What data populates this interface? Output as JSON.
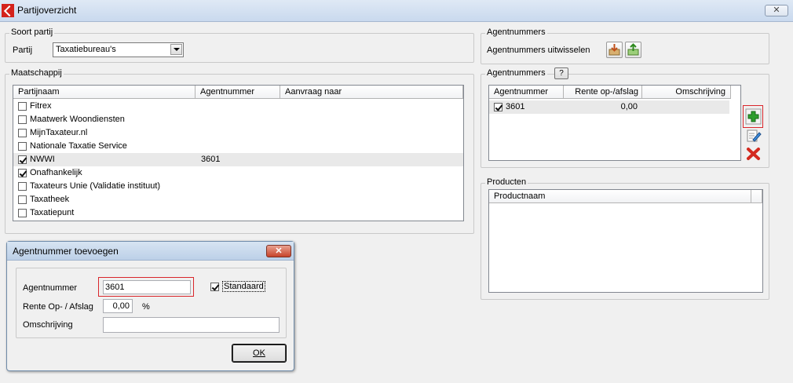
{
  "window": {
    "title": "Partijoverzicht",
    "close_glyph": "✕",
    "icon": "app-logo-icon"
  },
  "soort_partij": {
    "legend": "Soort partij",
    "partij_label": "Partij",
    "partij_value": "Taxatiebureau's"
  },
  "maatschappij": {
    "legend": "Maatschappij",
    "columns": [
      "Partijnaam",
      "Agentnummer",
      "Aanvraag naar"
    ],
    "rows": [
      {
        "name": "Fitrex",
        "agentnummer": "",
        "aanvraag": "",
        "checked": false
      },
      {
        "name": "Maatwerk Woondiensten",
        "agentnummer": "",
        "aanvraag": "",
        "checked": false
      },
      {
        "name": "MijnTaxateur.nl",
        "agentnummer": "",
        "aanvraag": "",
        "checked": false
      },
      {
        "name": "Nationale Taxatie Service",
        "agentnummer": "",
        "aanvraag": "",
        "checked": false
      },
      {
        "name": "NWWI",
        "agentnummer": "3601",
        "aanvraag": "",
        "checked": true
      },
      {
        "name": "Onafhankelijk",
        "agentnummer": "",
        "aanvraag": "",
        "checked": true
      },
      {
        "name": "Taxateurs Unie (Validatie instituut)",
        "agentnummer": "",
        "aanvraag": "",
        "checked": false
      },
      {
        "name": "Taxatheek",
        "agentnummer": "",
        "aanvraag": "",
        "checked": false
      },
      {
        "name": "Taxatiepunt",
        "agentnummer": "",
        "aanvraag": "",
        "checked": false
      }
    ],
    "selected_row_index": 4
  },
  "agentnummers_exchange": {
    "legend": "Agentnummers",
    "label": "Agentnummers uitwisselen",
    "import_icon": "import-icon",
    "export_icon": "export-icon"
  },
  "agentnummers": {
    "legend": "Agentnummers",
    "help_label": "?",
    "columns": [
      "Agentnummer",
      "Rente op-/afslag",
      "Omschrijving"
    ],
    "rows": [
      {
        "agentnummer": "3601",
        "rente": "0,00",
        "omschrijving": "",
        "checked": true
      }
    ],
    "add_icon": "add-icon",
    "edit_icon": "edit-icon",
    "delete_icon": "delete-icon"
  },
  "producten": {
    "legend": "Producten",
    "columns": [
      "Productnaam"
    ]
  },
  "dialog": {
    "title": "Agentnummer toevoegen",
    "close_glyph": "✕",
    "agentnummer_label": "Agentnummer",
    "agentnummer_value": "3601",
    "standaard_label": "Standaard",
    "standaard_checked": true,
    "rente_label": "Rente Op- / Afslag",
    "rente_value": "0,00",
    "rente_unit": "%",
    "omschrijving_label": "Omschrijving",
    "omschrijving_value": "",
    "ok_label": "OK"
  },
  "colors": {
    "highlight_red": "#d9262b",
    "titlebar": "#c9d9ee",
    "dialog_close": "#c7432a",
    "add_green": "#2e9e2e",
    "delete_red": "#d32a1f"
  }
}
